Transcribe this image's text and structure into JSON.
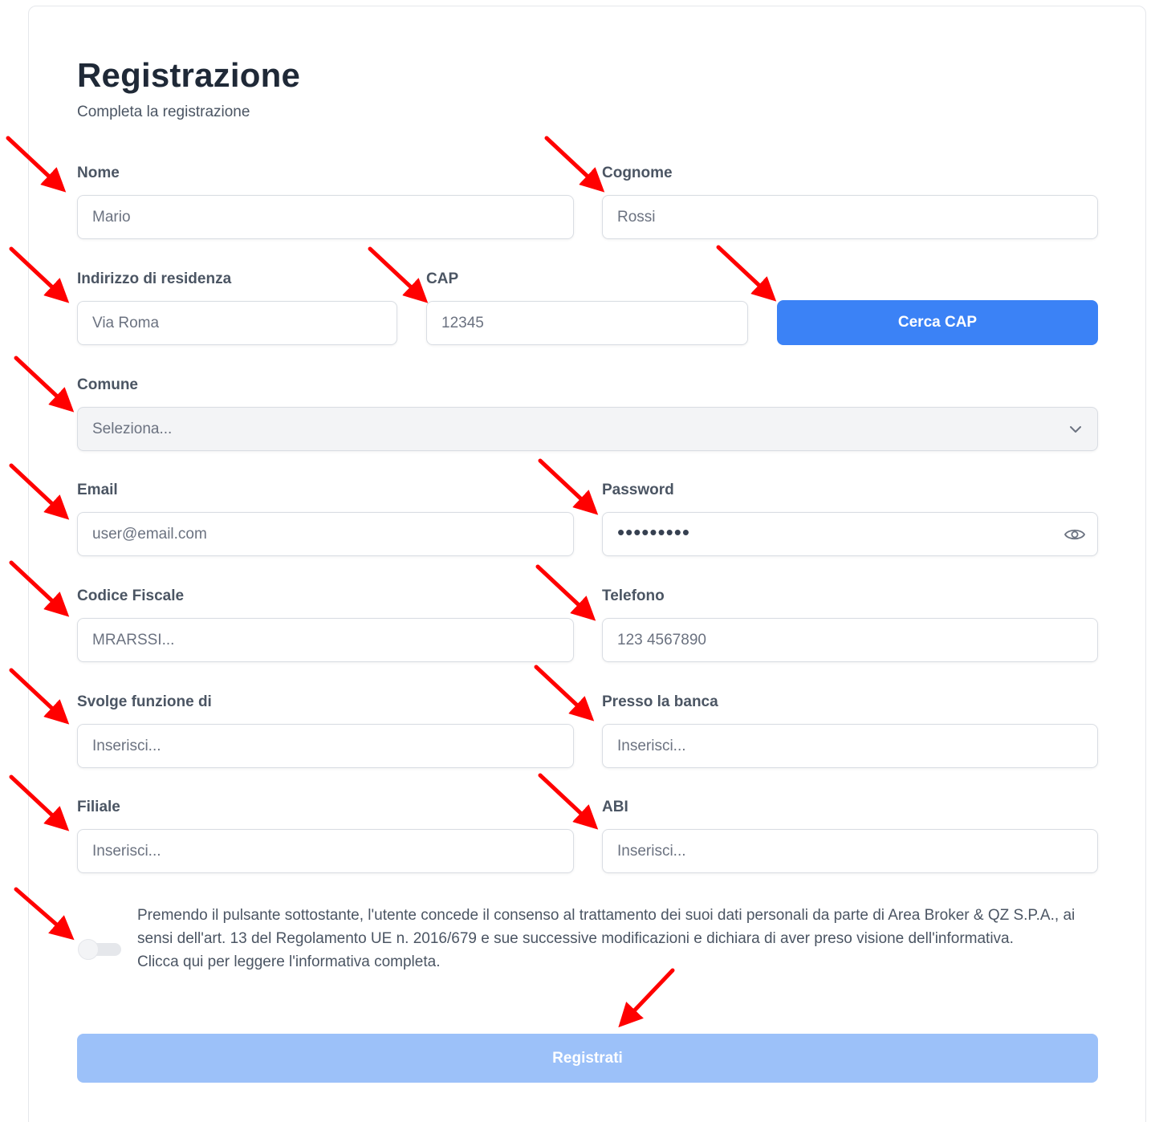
{
  "page": {
    "title": "Registrazione",
    "subtitle": "Completa la registrazione"
  },
  "form": {
    "nome": {
      "label": "Nome",
      "value": "Mario"
    },
    "cognome": {
      "label": "Cognome",
      "value": "Rossi"
    },
    "indirizzo": {
      "label": "Indirizzo di residenza",
      "value": "Via Roma"
    },
    "cap": {
      "label": "CAP",
      "value": "12345"
    },
    "cerca_cap_button": "Cerca CAP",
    "comune": {
      "label": "Comune",
      "placeholder": "Seleziona..."
    },
    "email": {
      "label": "Email",
      "value": "user@email.com"
    },
    "password": {
      "label": "Password",
      "value": "•••••••••"
    },
    "codice_fiscale": {
      "label": "Codice Fiscale",
      "value": "MRARSSI..."
    },
    "telefono": {
      "label": "Telefono",
      "value": "123 4567890"
    },
    "funzione": {
      "label": "Svolge funzione di",
      "placeholder": "Inserisci..."
    },
    "banca": {
      "label": "Presso la banca",
      "placeholder": "Inserisci..."
    },
    "filiale": {
      "label": "Filiale",
      "placeholder": "Inserisci..."
    },
    "abi": {
      "label": "ABI",
      "placeholder": "Inserisci..."
    },
    "consent": {
      "text": "Premendo il pulsante sottostante, l'utente concede il consenso al trattamento dei suoi dati personali da parte di Area Broker & QZ S.P.A., ai sensi dell'art. 13 del Regolamento UE n. 2016/679 e sue successive modificazioni e dichiara di aver preso visione dell'informativa.",
      "link": "Clicca qui per leggere l'informativa completa.",
      "toggle_on": false
    },
    "submit_button": "Registrati"
  },
  "colors": {
    "primary": "#3b82f6",
    "primary_disabled": "#9cc1f9",
    "annotation_arrow": "#ff0000"
  },
  "icons": [
    "chevron-down-icon",
    "eye-icon",
    "red-arrow-annotation"
  ]
}
